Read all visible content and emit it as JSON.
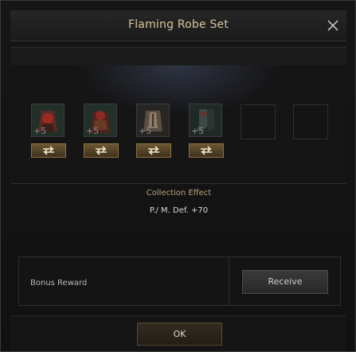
{
  "dialog": {
    "title": "Flaming Robe Set",
    "close_icon": "close-icon"
  },
  "items": [
    {
      "enhancement": "+5",
      "icon": "flaming-robe-icon",
      "swap_icon": "swap-arrows-icon",
      "filled": true
    },
    {
      "enhancement": "+5",
      "icon": "flaming-robe-cape-icon",
      "swap_icon": "swap-arrows-icon",
      "filled": true
    },
    {
      "enhancement": "+5",
      "icon": "robe-tunic-icon",
      "swap_icon": "swap-arrows-icon",
      "filled": true
    },
    {
      "enhancement": "+5",
      "icon": "robe-boots-icon",
      "swap_icon": "swap-arrows-icon",
      "filled": true
    },
    {
      "filled": false
    },
    {
      "filled": false
    }
  ],
  "collection": {
    "title": "Collection Effect",
    "value": "P./ M. Def. +70"
  },
  "bonus": {
    "label": "Bonus Reward",
    "receive_label": "Receive"
  },
  "footer": {
    "ok_label": "OK"
  },
  "colors": {
    "title": "#d9c49a",
    "swap_button": "#6a5632",
    "effect_title": "#b8a27a"
  }
}
